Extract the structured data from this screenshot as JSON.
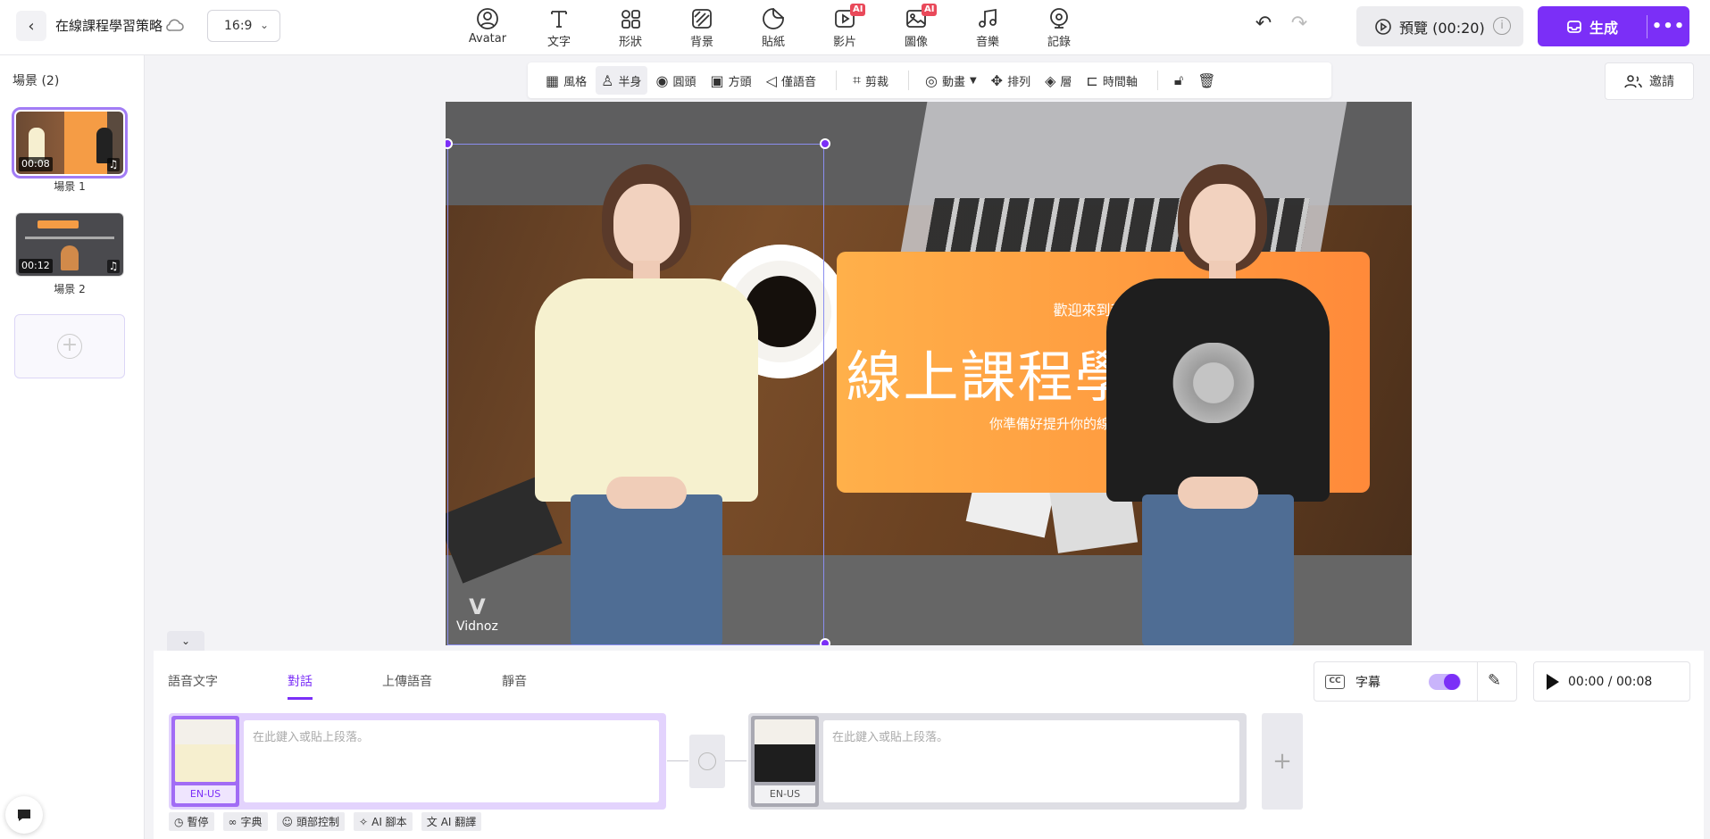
{
  "header": {
    "project_title": "在線課程學習策略",
    "aspect_ratio": "16:9",
    "tools": [
      {
        "label": "Avatar",
        "icon": "avatar-icon",
        "ai": false
      },
      {
        "label": "文字",
        "icon": "text-icon",
        "ai": false
      },
      {
        "label": "形狀",
        "icon": "shapes-icon",
        "ai": false
      },
      {
        "label": "背景",
        "icon": "background-icon",
        "ai": false
      },
      {
        "label": "貼紙",
        "icon": "sticker-icon",
        "ai": false
      },
      {
        "label": "影片",
        "icon": "video-icon",
        "ai": true
      },
      {
        "label": "圖像",
        "icon": "image-icon",
        "ai": true
      },
      {
        "label": "音樂",
        "icon": "music-icon",
        "ai": false
      },
      {
        "label": "記錄",
        "icon": "record-icon",
        "ai": false
      }
    ],
    "ai_badge": "AI",
    "preview_label": "預覽 (00:20)",
    "generate_label": "生成",
    "more_label": "•••"
  },
  "sidebar": {
    "title": "場景 (2)",
    "scenes": [
      {
        "label": "場景 1",
        "duration": "00:08",
        "active": true
      },
      {
        "label": "場景 2",
        "duration": "00:12",
        "active": false
      }
    ]
  },
  "canvas_toolbar": {
    "items": [
      "風格",
      "半身",
      "圓頭",
      "方頭",
      "僅語音",
      "剪裁",
      "動畫",
      "排列",
      "層",
      "時間軸"
    ],
    "active_item": "半身"
  },
  "invite_label": "邀請",
  "canvas": {
    "banner_kicker": "歡迎來到我們的",
    "banner_title": "線上課程學習策略。",
    "banner_subtitle": "你準備好提升你的線上學習旅程了嗎？",
    "logo_text": "Vidnoz"
  },
  "bottom_panel": {
    "tabs": [
      "語音文字",
      "對話",
      "上傳語音",
      "靜音"
    ],
    "active_tab": "對話",
    "subtitle_label": "字幕",
    "subtitle_enabled": true,
    "time_display": "00:00 / 00:08",
    "segments": [
      {
        "locale": "EN-US",
        "placeholder": "在此鍵入或貼上段落。"
      },
      {
        "locale": "EN-US",
        "placeholder": "在此鍵入或貼上段落。"
      }
    ],
    "chips": [
      "暫停",
      "字典",
      "頭部控制",
      "AI 腳本",
      "AI 翻譯"
    ]
  },
  "colors": {
    "accent": "#7b2ff7",
    "banner": "#ff9a3f"
  }
}
